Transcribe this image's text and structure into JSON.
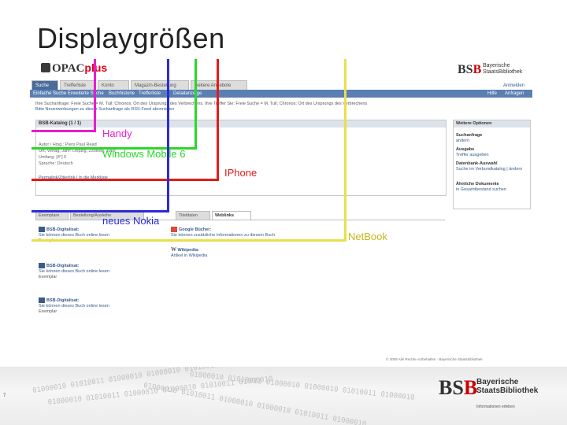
{
  "slide": {
    "title": "Displaygrößen",
    "number": "7"
  },
  "opac": {
    "logo_text": "OPAC",
    "logo_plus": "plus",
    "tabs": [
      "Suche",
      "Trefferliste",
      "Konto",
      "Magazin-Bestellung",
      "weitere Angebote"
    ],
    "util_top": "Anmelden",
    "util_help": "Hilfe",
    "util_req": "Anfragen",
    "subnav": [
      "Einfache Suche",
      "Erweiterte Suche",
      "Buchhistorie",
      "Trefferliste",
      "Detailanzeige"
    ],
    "search_line1": "Ihre Suchanfrage: Freie Suche = M. Tull; Chronos; Ort des Ursprungs des Verbrechens. Ihre Treffer Sie: Freie Suche = M. Tull; Chronos; Ort des Ursprungs des Verbrechens",
    "search_line2": "Bitte Neuerwerbungen zu dieser Suchanfrage als RSS-Feed abonnieren",
    "catalog_head": "BSB-Katalog (1 / 1)",
    "record_lines": [
      "Autor / Hrsg.: Piers Paul Read",
      "Ort, Verlag, Jahr: Leipzig, Zsolnay, 2003",
      "Umfang: [4°] 5",
      "Sprache: Deutsch"
    ],
    "permalink": "Permalink/Zitierlink | In die Merkliste",
    "options_head": "Weitere Optionen",
    "options": [
      {
        "title": "Suchanfrage",
        "link": "ändern"
      },
      {
        "title": "Ausgabe",
        "link": "Treffer ausgeben"
      },
      {
        "title": "Datenbank-Auswahl",
        "link": "Auswahl"
      },
      {
        "title": "",
        "link": "Suche im Verbundkatalog | ändern"
      },
      {
        "title": "Ähnliche Dokumente",
        "link": "in Gesamtbestand suchen"
      }
    ],
    "lower_tabs": [
      "Exemplare",
      "Bestellung/Ausleihe",
      "Titeldaten",
      "Weblinks"
    ],
    "lower_left": [
      {
        "title": "BSB-Digitalisat:",
        "text": "Sie können dieses Buch online lesen",
        "meta": "Exemplar"
      },
      {
        "title": "BSB-Digitalisat:",
        "text": "Sie können dieses Buch online lesen",
        "meta": "Exemplar"
      },
      {
        "title": "BSB-Digitalisat:",
        "text": "Sie können dieses Buch online lesen",
        "meta": "Exemplar"
      }
    ],
    "google_title": "Google Bücher:",
    "google_text": "Sie können zusätzliche Informationen zu diesem Buch",
    "wiki_title": "Wikipedia:",
    "wiki_text": "Artikel in Wikipedia",
    "footer": "© 2009 Alle Rechte vorbehalten · Bayerische Staatsbibliothek"
  },
  "bsb": {
    "mark_b": "BS",
    "mark_s": "B",
    "name_line1": "Bayerische",
    "name_line2": "Staats",
    "name_line3": "Bibliothek",
    "tagline": "Informationen erleben"
  },
  "devices": [
    {
      "label": "Handy",
      "color": "#e51fcb"
    },
    {
      "label": "Windows Mobile 6",
      "color": "#2bd62b"
    },
    {
      "label": "IPhone",
      "color": "#e11c1c"
    },
    {
      "label": "neues Nokia",
      "color": "#2b2bd6"
    },
    {
      "label": "NetBook",
      "color": "#e8e04a"
    }
  ],
  "binary_text": "01000010 01010011 01000010 01000010 01010011 01000010"
}
